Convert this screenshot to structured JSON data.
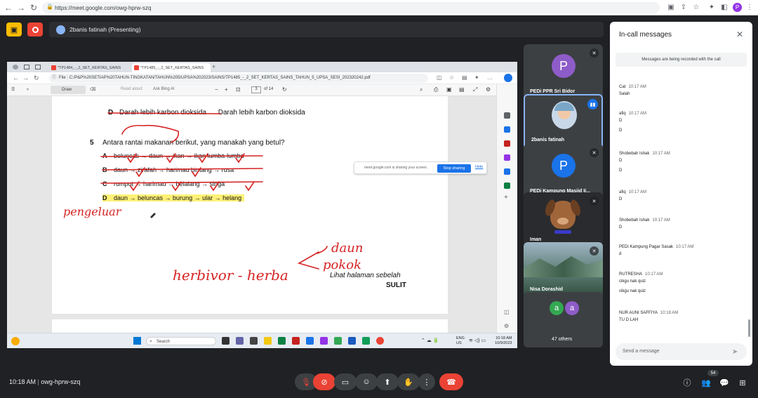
{
  "browser": {
    "url": "https://meet.google.com/owg-hprw-szq",
    "profile_initial": "P"
  },
  "meet": {
    "presenter_label": "2banis fatinah (Presenting)",
    "meeting_time": "10:18 AM",
    "meeting_code": "owg-hprw-szq",
    "participant_count": "54"
  },
  "shared_screen": {
    "tabs": [
      {
        "label": "*TP1484_-_2_SET_KERTAS_SAINS"
      },
      {
        "label": "*TP1485_-_2_SET_KERTAS_SAINS"
      }
    ],
    "file_label": "File",
    "pdf_path": "C:/P&P%20SETIAP%20TAHUN-TINGKATAN/TAHUN%205/UPSA%202023/SAINS/TP1485_-_2_SET_KERTAS_SAINS_TAHUN_5_UPSA_SESI_202320242.pdf",
    "toolbar": {
      "draw_label": "Draw",
      "read_aloud": "Read aloud",
      "ask_bing": "Ask Bing AI",
      "page_num": "3",
      "page_total": "of 14"
    },
    "pdf": {
      "top_left_text": "Darah lebih karbon dioksida",
      "top_right_text": "Darah lebih karbon dioksida",
      "question_number": "5",
      "question_text": "Antara rantai makanan berikut, yang manakah yang betul?",
      "options": [
        {
          "letter": "A",
          "text": "beluncas → daun → ikan → ikan lumba-lumba"
        },
        {
          "letter": "B",
          "text": "daun → zirafah → harimau bintang → rusa"
        },
        {
          "letter": "C",
          "text": "rumput → harimau → belalang → singa"
        },
        {
          "letter": "D",
          "text": "daun → beluncas → burung → ular → helang"
        }
      ],
      "footer_italic": "Lihat halaman sebelah",
      "footer_bold": "SULIT",
      "handwriting": {
        "pengeluar": "pengeluar",
        "herbivor": "herbivor - herba",
        "daun": "daun",
        "pokok": "pokok"
      }
    },
    "share_notice": {
      "text": "meet.google.com is sharing your screen.",
      "stop_label": "Stop sharing",
      "hide_label": "Hide"
    },
    "taskbar": {
      "search_label": "Search",
      "lang_line1": "ENG",
      "lang_line2": "US",
      "clock_time": "10:18 AM",
      "clock_date": "10/9/2023"
    }
  },
  "participants": [
    {
      "name": "PEDi PPR Sri Bidor",
      "initial": "P",
      "color": "#8e5cc9"
    },
    {
      "name": "2banis fatinah"
    },
    {
      "name": "PEDi Kampung Masjid Ij...",
      "initial": "P",
      "color": "#1a73e8"
    },
    {
      "name": "Iman"
    },
    {
      "name": "Nisa Dorashid"
    },
    {
      "name": "47 others",
      "a1": "a",
      "a2": "a",
      "c1": "#34a853",
      "c2": "#8e5cc9"
    }
  ],
  "chat": {
    "title": "In-call messages",
    "recording_note": "Messages are being recorded with the call",
    "messages": [
      {
        "sender": "Cat",
        "time": "10:17 AM",
        "lines": [
          "Salah"
        ]
      },
      {
        "sender": "afiq",
        "time": "10:17 AM",
        "lines": [
          "D",
          "D"
        ]
      },
      {
        "sender": "Shobebah Ishak",
        "time": "10:17 AM",
        "lines": [
          "D",
          "D"
        ]
      },
      {
        "sender": "afiq",
        "time": "10:17 AM",
        "lines": [
          "D"
        ]
      },
      {
        "sender": "Shobebah Ishak",
        "time": "10:17 AM",
        "lines": [
          "D"
        ]
      },
      {
        "sender": "PEDi Kampung Pagar Sasak",
        "time": "10:17 AM",
        "lines": [
          "d"
        ]
      },
      {
        "sender": "RUTRESHA",
        "time": "10:17 AM",
        "lines": [
          "cikgu nak quiz",
          "cikgu nak quiz"
        ]
      },
      {
        "sender": "NUR AUNI SAFFIYA",
        "time": "10:18 AM",
        "lines": [
          "TU D LAH"
        ]
      }
    ],
    "send_placeholder": "Send a message"
  },
  "colors": {
    "accent": "#1a73e8",
    "leave_red": "#ea4335",
    "presenting_yellow": "#fbbc04",
    "ink_red": "#d62323",
    "highlight": "#fff176"
  }
}
